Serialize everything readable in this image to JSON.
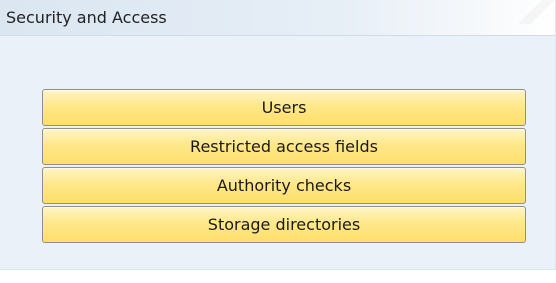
{
  "panel": {
    "title": "Security and Access"
  },
  "buttons": [
    {
      "label": "Users"
    },
    {
      "label": "Restricted access fields"
    },
    {
      "label": "Authority checks"
    },
    {
      "label": "Storage directories"
    }
  ],
  "colors": {
    "panel_bg": "#eaf1f8",
    "button_bg": "#ffe88a",
    "button_border": "#8f8f8f"
  }
}
